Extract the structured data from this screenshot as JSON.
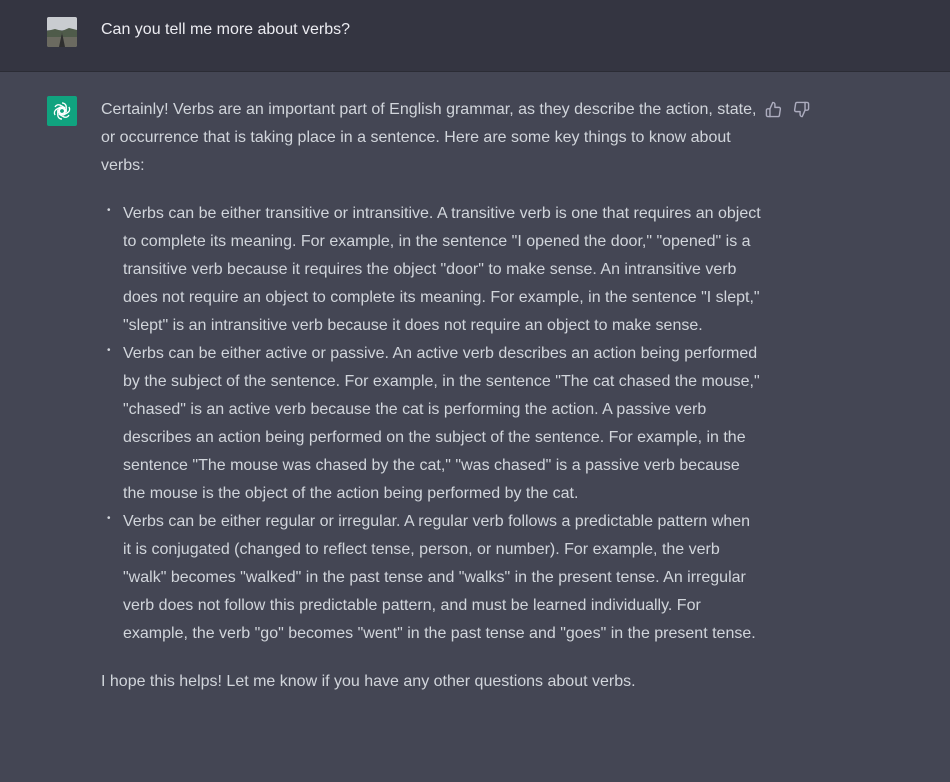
{
  "user_message": {
    "text": "Can you tell me more about verbs?"
  },
  "assistant_message": {
    "intro": "Certainly! Verbs are an important part of English grammar, as they describe the action, state, or occurrence that is taking place in a sentence. Here are some key things to know about verbs:",
    "points": [
      "Verbs can be either transitive or intransitive. A transitive verb is one that requires an object to complete its meaning. For example, in the sentence \"I opened the door,\" \"opened\" is a transitive verb because it requires the object \"door\" to make sense. An intransitive verb does not require an object to complete its meaning. For example, in the sentence \"I slept,\" \"slept\" is an intransitive verb because it does not require an object to make sense.",
      "Verbs can be either active or passive. An active verb describes an action being performed by the subject of the sentence. For example, in the sentence \"The cat chased the mouse,\" \"chased\" is an active verb because the cat is performing the action. A passive verb describes an action being performed on the subject of the sentence. For example, in the sentence \"The mouse was chased by the cat,\" \"was chased\" is a passive verb because the mouse is the object of the action being performed by the cat.",
      "Verbs can be either regular or irregular. A regular verb follows a predictable pattern when it is conjugated (changed to reflect tense, person, or number). For example, the verb \"walk\" becomes \"walked\" in the past tense and \"walks\" in the present tense. An irregular verb does not follow this predictable pattern, and must be learned individually. For example, the verb \"go\" becomes \"went\" in the past tense and \"goes\" in the present tense."
    ],
    "closing": "I hope this helps! Let me know if you have any other questions about verbs."
  },
  "icons": {
    "assistant_avatar": "openai-logo-icon",
    "thumbs_up": "thumbs-up-icon",
    "thumbs_down": "thumbs-down-icon"
  },
  "colors": {
    "user_row_bg": "#343541",
    "assistant_row_bg": "#444654",
    "assistant_avatar_bg": "#10a37f",
    "text": "#d1d5db"
  }
}
